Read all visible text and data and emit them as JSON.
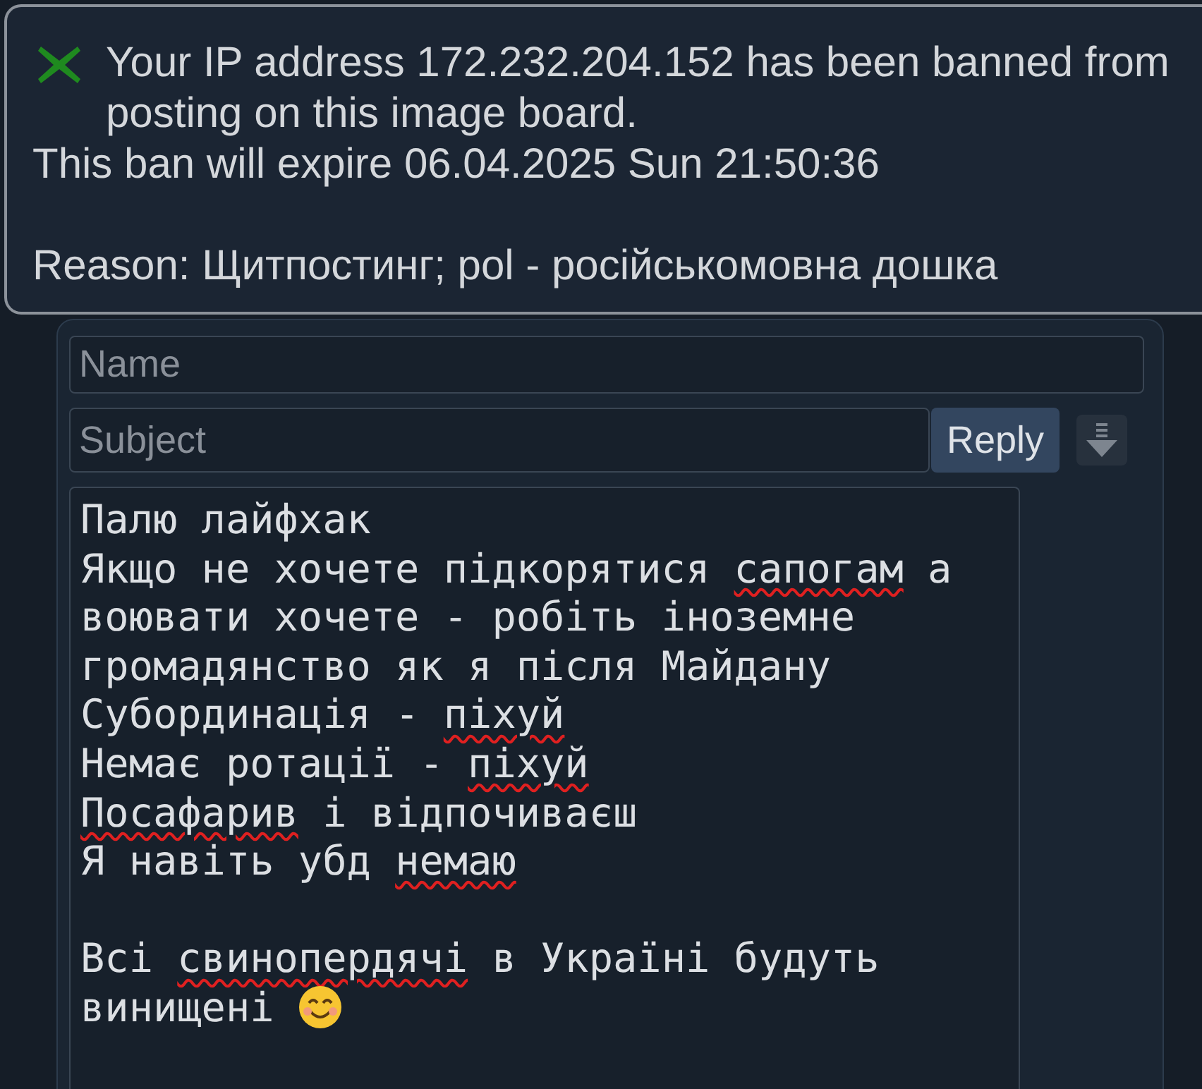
{
  "ban_notice": {
    "message": "Your IP address 172.232.204.152 has been banned from posting on this image board.",
    "expiry": "This ban will expire 06.04.2025 Sun 21:50:36",
    "reason": "Reason: Щитпостинг; pol - російськомовна дошка"
  },
  "form": {
    "name_field": {
      "placeholder": "Name"
    },
    "subject_field": {
      "placeholder": "Subject"
    },
    "reply_button": "Reply",
    "message_lines": [
      {
        "kind": "text",
        "segments": [
          {
            "text": "Палю лайфхак",
            "misspelled": false
          }
        ]
      },
      {
        "kind": "text",
        "segments": [
          {
            "text": "Якщо не хочете підкорятися ",
            "misspelled": false
          },
          {
            "text": "сапогам",
            "misspelled": true
          },
          {
            "text": " а",
            "misspelled": false
          }
        ]
      },
      {
        "kind": "text",
        "segments": [
          {
            "text": "воювати хочете - робіть іноземне",
            "misspelled": false
          }
        ]
      },
      {
        "kind": "text",
        "segments": [
          {
            "text": "громадянство як я після Майдану",
            "misspelled": false
          }
        ]
      },
      {
        "kind": "text",
        "segments": [
          {
            "text": "Субординація - ",
            "misspelled": false
          },
          {
            "text": "піхуй",
            "misspelled": true
          }
        ]
      },
      {
        "kind": "text",
        "segments": [
          {
            "text": "Немає ротації - ",
            "misspelled": false
          },
          {
            "text": "піхуй",
            "misspelled": true
          }
        ]
      },
      {
        "kind": "text",
        "segments": [
          {
            "text": "Посафарив",
            "misspelled": true
          },
          {
            "text": " і відпочиваєш",
            "misspelled": false
          }
        ]
      },
      {
        "kind": "text",
        "segments": [
          {
            "text": "Я навіть убд ",
            "misspelled": false
          },
          {
            "text": "немаю",
            "misspelled": true
          }
        ]
      },
      {
        "kind": "blank"
      },
      {
        "kind": "text",
        "segments": [
          {
            "text": "Всі ",
            "misspelled": false
          },
          {
            "text": "свинопердячі",
            "misspelled": true
          },
          {
            "text": " в Україні будуть",
            "misspelled": false
          }
        ]
      },
      {
        "kind": "text",
        "segments": [
          {
            "text": "винищені",
            "misspelled": false
          }
        ]
      }
    ]
  }
}
